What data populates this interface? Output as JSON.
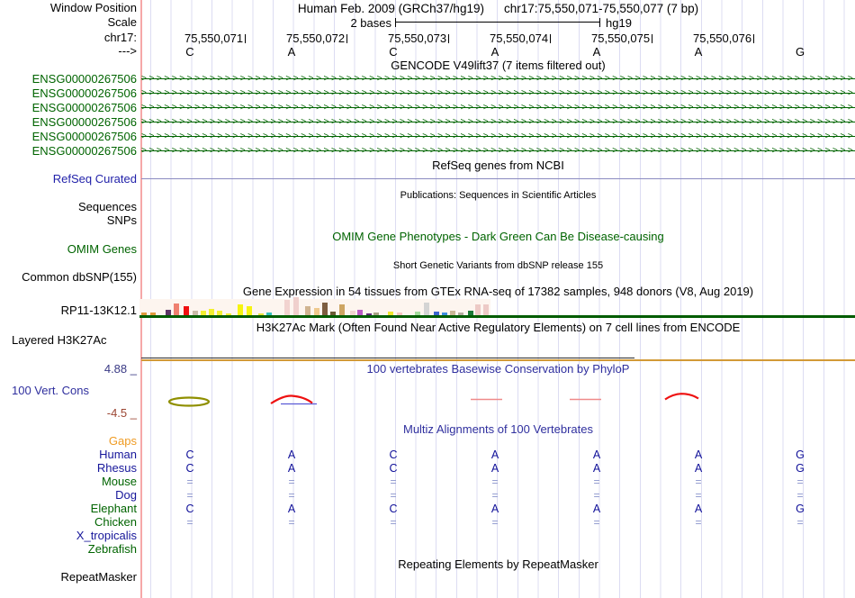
{
  "header": {
    "assembly": "Human Feb. 2009 (GRCh37/hg19)",
    "position": "chr17:75,550,071-75,550,077 (7 bp)",
    "scale_value": "2 bases",
    "genome": "hg19"
  },
  "gutter": {
    "window_position": "Window Position",
    "scale": "Scale",
    "chrom": "chr17:",
    "direction": "--->"
  },
  "ruler": {
    "positions": [
      "75,550,071",
      "75,550,072",
      "75,550,073",
      "75,550,074",
      "75,550,075",
      "75,550,076"
    ]
  },
  "sequence": {
    "bases": [
      "C",
      "A",
      "C",
      "A",
      "A",
      "A",
      "G"
    ]
  },
  "gencode": {
    "title": "GENCODE V49lift37 (7 items filtered out)",
    "genes": [
      "ENSG00000267506",
      "ENSG00000267506",
      "ENSG00000267506",
      "ENSG00000267506",
      "ENSG00000267506",
      "ENSG00000267506"
    ]
  },
  "refseq": {
    "title": "RefSeq genes from NCBI",
    "label": "RefSeq Curated"
  },
  "publications": {
    "title": "Publications: Sequences in Scientific Articles",
    "label": "Sequences"
  },
  "snps": {
    "label": "SNPs"
  },
  "omim": {
    "title": "OMIM Gene Phenotypes - Dark Green Can Be Disease-causing",
    "label": "OMIM Genes"
  },
  "dbsnp": {
    "title": "Short Genetic Variants from dbSNP release 155",
    "label": "Common dbSNP(155)"
  },
  "gtex": {
    "title": "Gene Expression in 54 tissues from GTEx RNA-seq of 17382 samples, 948 donors (V8, Aug 2019)",
    "label": "RP11-13K12.1",
    "bars": [
      [
        157,
        3,
        "#e09a3c"
      ],
      [
        167,
        3,
        "#e09a3c"
      ],
      [
        184,
        6,
        "#5c3566"
      ],
      [
        193,
        13,
        "#ef8070"
      ],
      [
        204,
        10,
        "#f01010"
      ],
      [
        214,
        5,
        "#c9baa7"
      ],
      [
        223,
        5,
        "#f2ef30"
      ],
      [
        232,
        7,
        "#f2ef30"
      ],
      [
        241,
        5,
        "#f2ef30"
      ],
      [
        251,
        2,
        "#f2ef30"
      ],
      [
        264,
        12,
        "#f6f410"
      ],
      [
        274,
        10,
        "#f6f410"
      ],
      [
        287,
        2,
        "#e8e43a"
      ],
      [
        296,
        3,
        "#35c0bc"
      ],
      [
        316,
        17,
        "#f2d3d0"
      ],
      [
        326,
        20,
        "#f0d0cd"
      ],
      [
        339,
        10,
        "#d0b491"
      ],
      [
        349,
        8,
        "#efc98e"
      ],
      [
        358,
        14,
        "#7d5e41"
      ],
      [
        367,
        4,
        "#6b5b35"
      ],
      [
        377,
        12,
        "#cda563"
      ],
      [
        389,
        5,
        "#f2d3d0"
      ],
      [
        397,
        6,
        "#b95cc4"
      ],
      [
        407,
        2,
        "#5e2b77"
      ],
      [
        415,
        3,
        "#a8a184"
      ],
      [
        431,
        4,
        "#efe52c"
      ],
      [
        441,
        3,
        "#f5c6c0"
      ],
      [
        461,
        4,
        "#a5dc9e"
      ],
      [
        471,
        14,
        "#d4d4d4"
      ],
      [
        482,
        4,
        "#3c65cf"
      ],
      [
        491,
        3,
        "#3f8de0"
      ],
      [
        500,
        5,
        "#c9b795"
      ],
      [
        509,
        3,
        "#b5ada0"
      ],
      [
        520,
        5,
        "#1b7837"
      ],
      [
        528,
        12,
        "#edcac6"
      ],
      [
        537,
        12,
        "#edcac6"
      ]
    ]
  },
  "h3k27ac": {
    "title": "H3K27Ac Mark (Often Found Near Active Regulatory Elements) on 7 cell lines from ENCODE",
    "label": "Layered H3K27Ac"
  },
  "phylop": {
    "title": "100 vertebrates Basewise Conservation by PhyloP",
    "label": "100 Vert. Cons",
    "max": "4.88 _",
    "min": "-4.5 _"
  },
  "multiz": {
    "title": "Multiz Alignments of 100 Vertebrates",
    "gaps_label": "Gaps",
    "rows": [
      {
        "label": "Human",
        "color": "navy",
        "cells": [
          "C",
          "A",
          "C",
          "A",
          "A",
          "A",
          "G"
        ]
      },
      {
        "label": "Rhesus",
        "color": "navy",
        "cells": [
          "C",
          "A",
          "C",
          "A",
          "A",
          "A",
          "G"
        ]
      },
      {
        "label": "Mouse",
        "color": "green",
        "cells": [
          "=",
          "=",
          "=",
          "=",
          "=",
          "=",
          "="
        ]
      },
      {
        "label": "Dog",
        "color": "navy",
        "cells": [
          "=",
          "=",
          "=",
          "=",
          "=",
          "=",
          "="
        ]
      },
      {
        "label": "Elephant",
        "color": "green",
        "cells": [
          "C",
          "A",
          "C",
          "A",
          "A",
          "A",
          "G"
        ]
      },
      {
        "label": "Chicken",
        "color": "green",
        "cells": [
          "=",
          "=",
          "=",
          "=",
          "=",
          "=",
          "="
        ]
      },
      {
        "label": "X_tropicalis",
        "color": "navy",
        "cells": [
          "",
          "",
          "",
          "",
          "",
          "",
          ""
        ]
      },
      {
        "label": "Zebrafish",
        "color": "green",
        "cells": [
          "",
          "",
          "",
          "",
          "",
          "",
          ""
        ]
      }
    ]
  },
  "repeatmasker": {
    "title": "Repeating Elements by RepeatMasker",
    "label": "RepeatMasker"
  },
  "colors": {
    "gencode_green": "#006400",
    "refseq_blue": "#2222aa",
    "conservation_red": "#ee1111",
    "conservation_olive": "#8f8f00",
    "signal_orange": "#d29a36",
    "guide_line": "#dcdcf2",
    "origin_line": "#f6a8a8"
  }
}
